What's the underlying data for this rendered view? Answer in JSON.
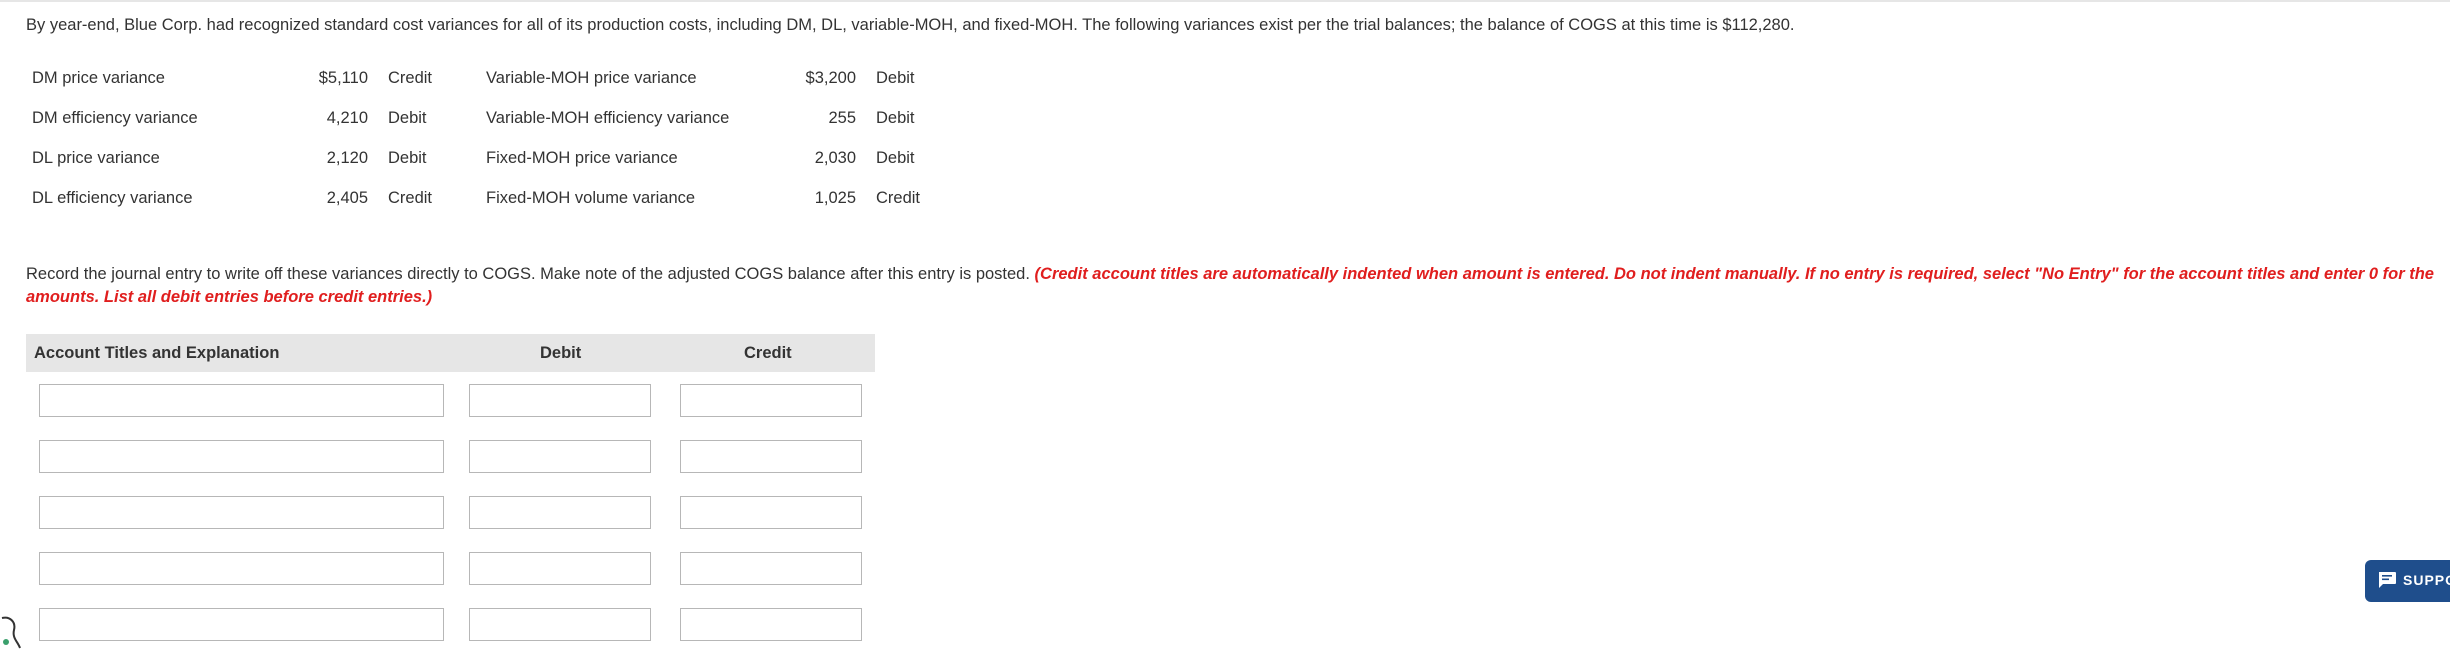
{
  "intro": "By year-end, Blue Corp. had recognized standard cost variances for all of its production costs, including DM, DL, variable-MOH, and fixed-MOH. The following variances exist per the trial balances; the balance of COGS at this time is $112,280.",
  "variances": [
    {
      "label_left": "DM price variance",
      "amount_left": "$5,110",
      "side_left": "Credit",
      "label_right": "Variable-MOH price variance",
      "amount_right": "$3,200",
      "side_right": "Debit"
    },
    {
      "label_left": "DM efficiency variance",
      "amount_left": "4,210",
      "side_left": "Debit",
      "label_right": "Variable-MOH efficiency variance",
      "amount_right": "255",
      "side_right": "Debit"
    },
    {
      "label_left": "DL price variance",
      "amount_left": "2,120",
      "side_left": "Debit",
      "label_right": "Fixed-MOH price variance",
      "amount_right": "2,030",
      "side_right": "Debit"
    },
    {
      "label_left": "DL efficiency variance",
      "amount_left": "2,405",
      "side_left": "Credit",
      "label_right": "Fixed-MOH volume variance",
      "amount_right": "1,025",
      "side_right": "Credit"
    }
  ],
  "instructions": {
    "text": "Record the journal entry to write off these variances directly to COGS. Make note of the adjusted COGS balance after this entry is posted.",
    "note": "(Credit account titles are automatically indented when amount is entered. Do not indent manually. If no entry is required, select \"No Entry\" for the account titles and enter 0 for the amounts. List all debit entries before credit entries.)"
  },
  "journal": {
    "headers": {
      "account": "Account Titles and Explanation",
      "debit": "Debit",
      "credit": "Credit"
    },
    "rows": [
      {
        "account": "",
        "debit": "",
        "credit": ""
      },
      {
        "account": "",
        "debit": "",
        "credit": ""
      },
      {
        "account": "",
        "debit": "",
        "credit": ""
      },
      {
        "account": "",
        "debit": "",
        "credit": ""
      },
      {
        "account": "",
        "debit": "",
        "credit": ""
      }
    ]
  },
  "support": {
    "label": "SUPPORT",
    "icon": "chat-icon",
    "color": "#1f4e8c"
  },
  "colors": {
    "note": "#e01e1e",
    "header_bg": "#e6e6e6"
  }
}
